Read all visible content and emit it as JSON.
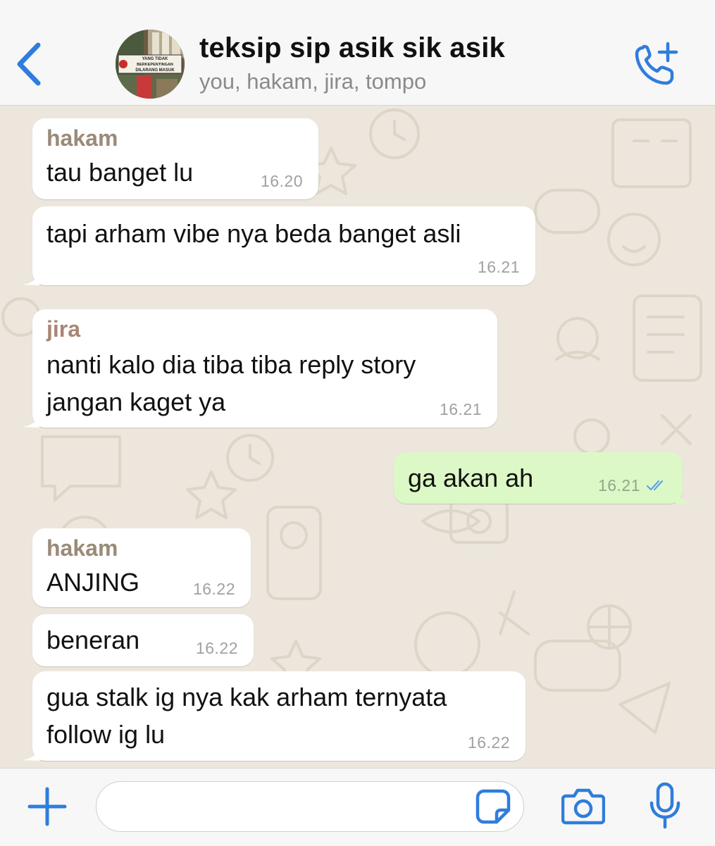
{
  "header": {
    "title": "teksip sip asik sik asik",
    "subtitle": "you, hakam, jira, tompo",
    "avatar_sign_text": [
      "YANG TIDAK",
      "BERKEPENTINGAN",
      "DILARANG MASUK"
    ]
  },
  "messages": [
    {
      "sender": "hakam",
      "lines": [
        "tau banget lu"
      ],
      "time": "16.20",
      "direction": "incoming"
    },
    {
      "sender": "",
      "lines": [
        "tapi arham vibe nya beda banget asli"
      ],
      "time": "16.21",
      "direction": "incoming"
    },
    {
      "sender": "jira",
      "lines": [
        "nanti kalo dia tiba tiba reply story",
        "jangan kaget ya"
      ],
      "time": "16.21",
      "direction": "incoming"
    },
    {
      "sender": "",
      "lines": [
        "ga akan ah"
      ],
      "time": "16.21",
      "direction": "outgoing",
      "status": "read"
    },
    {
      "sender": "hakam",
      "lines": [
        "ANJING"
      ],
      "time": "16.22",
      "direction": "incoming"
    },
    {
      "sender": "",
      "lines": [
        "beneran"
      ],
      "time": "16.22",
      "direction": "incoming"
    },
    {
      "sender": "",
      "lines": [
        "gua stalk ig nya kak arham ternyata",
        "follow ig lu"
      ],
      "time": "16.22",
      "direction": "incoming"
    }
  ],
  "composer": {
    "value": "",
    "placeholder": ""
  },
  "icons": {
    "back": "chevron-left-icon",
    "call": "add-call-icon",
    "attach": "plus-icon",
    "sticker": "sticker-icon",
    "camera": "camera-icon",
    "mic": "microphone-icon"
  },
  "colors": {
    "accent": "#2f7ddc",
    "outgoing_bubble": "#dcf8c6",
    "incoming_bubble": "#ffffff",
    "wallpaper": "#ece6dc",
    "sender_hakam": "#9a8a78",
    "sender_jira": "#a88674",
    "read_ticks": "#5aa6e8"
  }
}
